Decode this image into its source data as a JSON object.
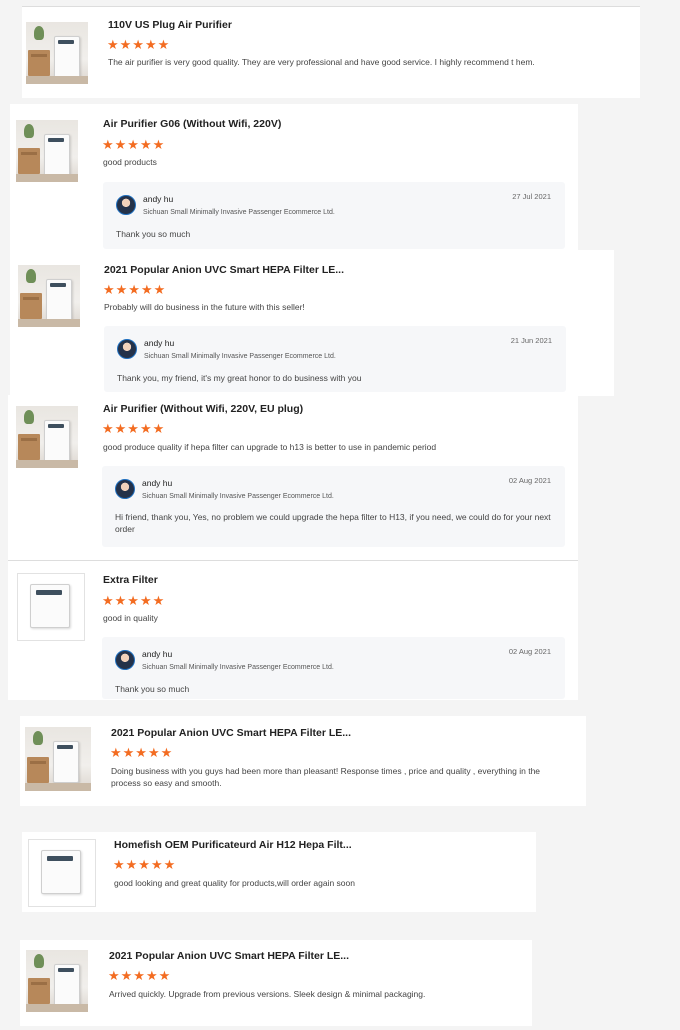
{
  "reviews": [
    {
      "product": "110V US Plug Air Purifier",
      "stars": "★★★★★",
      "text": "The air purifier is very good quality. They are very professional and have good service. I highly recommend t hem."
    },
    {
      "product": "Air Purifier G06 (Without Wifi, 220V)",
      "stars": "★★★★★",
      "text": "good products",
      "reply": {
        "name": "andy hu",
        "company": "Sichuan Small Minimally Invasive Passenger Ecommerce Ltd.",
        "date": "27 Jul 2021",
        "text": "Thank you so much"
      }
    },
    {
      "product": "2021 Popular Anion UVC Smart HEPA Filter LE...",
      "stars": "★★★★★",
      "text": "Probably will do business in the future with this seller!",
      "reply": {
        "name": "andy hu",
        "company": "Sichuan Small Minimally Invasive Passenger Ecommerce Ltd.",
        "date": "21 Jun 2021",
        "text": "Thank you, my friend, it's my great honor to do business with you"
      }
    },
    {
      "product": "Air Purifier (Without Wifi, 220V, EU plug)",
      "stars": "★★★★★",
      "text": "good produce quality if hepa filter can upgrade to h13 is better to use in pandemic period",
      "reply": {
        "name": "andy hu",
        "company": "Sichuan Small Minimally Invasive Passenger Ecommerce Ltd.",
        "date": "02 Aug 2021",
        "text": "Hi friend, thank you, Yes, no problem we could upgrade the hepa filter to H13, if you need, we could do for your next order"
      }
    },
    {
      "product": "Extra Filter",
      "stars": "★★★★★",
      "text": "good in quality",
      "reply": {
        "name": "andy hu",
        "company": "Sichuan Small Minimally Invasive Passenger Ecommerce Ltd.",
        "date": "02 Aug 2021",
        "text": "Thank you so much"
      }
    },
    {
      "product": "2021 Popular Anion UVC Smart HEPA Filter LE...",
      "stars": "★★★★★",
      "text": "Doing business with you guys had been more than pleasant! Response times , price and quality , everything in the process so easy and smooth."
    },
    {
      "product": "Homefish OEM Purificateurd Air H12 Hepa Filt...",
      "stars": "★★★★★",
      "text": "good looking and great quality for products,will order again soon"
    },
    {
      "product": "2021 Popular Anion UVC Smart HEPA Filter LE...",
      "stars": "★★★★★",
      "text": "Arrived quickly. Upgrade from previous versions. Sleek design & minimal packaging."
    }
  ],
  "colors": {
    "star": "#f36c21",
    "reply_bg": "#f6f7f9"
  }
}
